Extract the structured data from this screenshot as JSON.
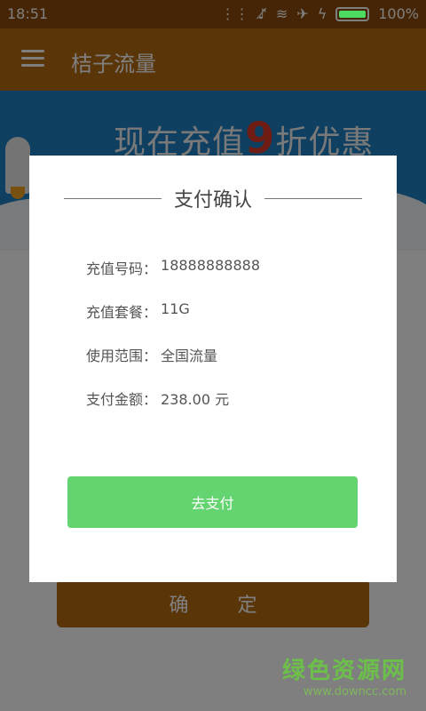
{
  "status_bar": {
    "time": "18:51",
    "battery": "100%",
    "battery_level": 1.0
  },
  "app_bar": {
    "title": "桔子流量",
    "menu_icon": "menu-icon"
  },
  "banner": {
    "text_before": "现在充值",
    "nine": "9",
    "text_after": "折优惠"
  },
  "page": {
    "confirm_label": "确 定"
  },
  "dialog": {
    "title": "支付确认",
    "rows": [
      {
        "label": "充值号码：",
        "value": "18888888888"
      },
      {
        "label": "充值套餐：",
        "value": "11G"
      },
      {
        "label": "使用范围：",
        "value": "全国流量"
      },
      {
        "label": "支付金额：",
        "value": "238.00 元"
      }
    ],
    "pay_button": "去支付"
  },
  "watermark": {
    "name": "绿色资源网",
    "url": "www.downcc.com"
  },
  "colors": {
    "brand": "#b36b10",
    "pay": "#63d46f"
  }
}
